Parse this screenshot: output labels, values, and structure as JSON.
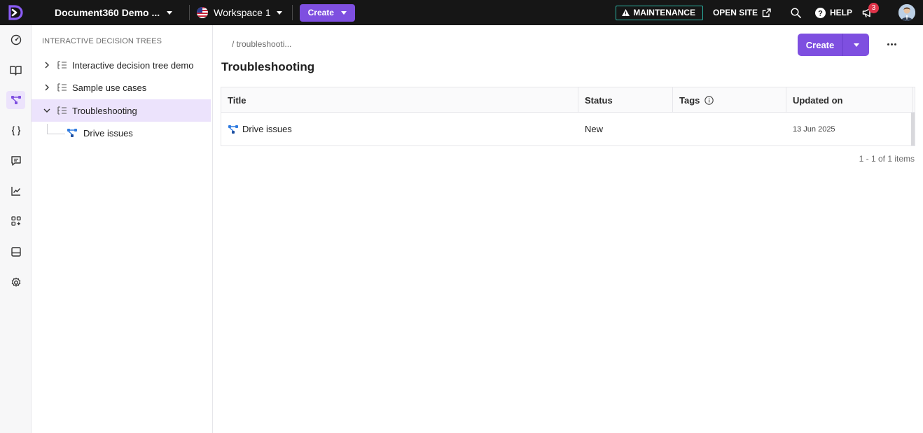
{
  "topbar": {
    "project_name": "Document360 Demo ...",
    "workspace": "Workspace 1",
    "create_label": "Create",
    "maintenance_label": "MAINTENANCE",
    "open_site_label": "OPEN SITE",
    "help_label": "HELP",
    "notification_count": "3"
  },
  "rail": {
    "items": [
      {
        "icon": "dashboard-icon",
        "active": false
      },
      {
        "icon": "book-icon",
        "active": false
      },
      {
        "icon": "decision-tree-icon",
        "active": true
      },
      {
        "icon": "curly-braces-icon",
        "active": false
      },
      {
        "icon": "feedback-icon",
        "active": false
      },
      {
        "icon": "analytics-icon",
        "active": false
      },
      {
        "icon": "widgets-icon",
        "active": false
      },
      {
        "icon": "layout-icon",
        "active": false
      },
      {
        "icon": "settings-icon",
        "active": false
      }
    ]
  },
  "tree": {
    "heading": "INTERACTIVE DECISION TREES",
    "items": [
      {
        "label": "Interactive decision tree demo",
        "expanded": false
      },
      {
        "label": "Sample use cases",
        "expanded": false
      },
      {
        "label": "Troubleshooting",
        "expanded": true,
        "active": true
      }
    ],
    "child": {
      "label": "Drive issues"
    }
  },
  "main": {
    "breadcrumb": "/ troubleshooti...",
    "title": "Troubleshooting",
    "create_label": "Create",
    "table": {
      "columns": [
        "Title",
        "Status",
        "Tags",
        "Updated on"
      ],
      "rows": [
        {
          "title": "Drive issues",
          "status": "New",
          "tags": "",
          "updated": "13 Jun 2025"
        }
      ]
    },
    "pager": "1 - 1 of 1 items"
  },
  "colors": {
    "accent": "#7e4fe0",
    "topbar": "#161616",
    "active_bg": "#ece3fc",
    "maintenance_border": "#2bb3a3",
    "tree_icon": "#2f7be0"
  }
}
